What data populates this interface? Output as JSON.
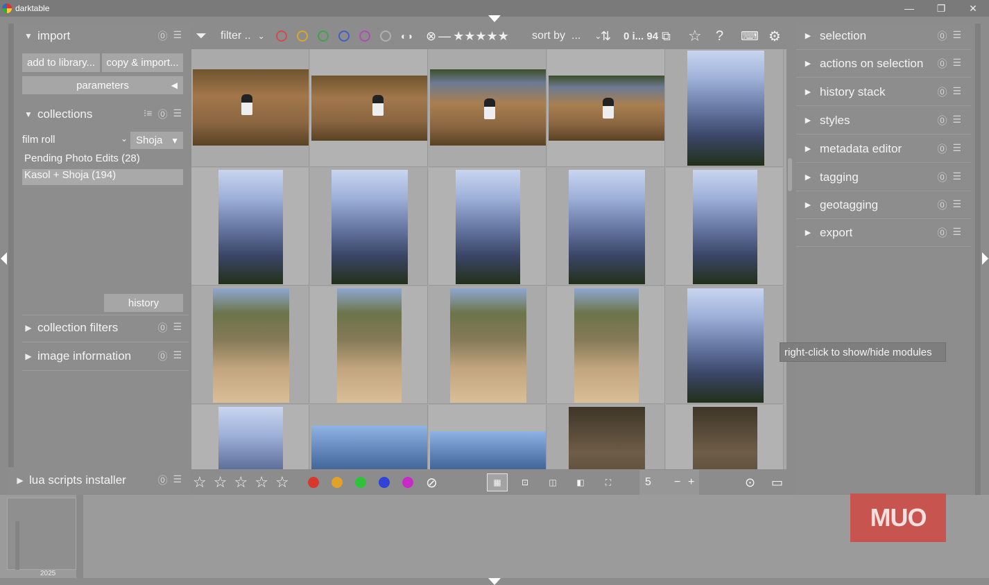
{
  "window": {
    "title": "darktable",
    "minimize": "—",
    "maximize": "❐",
    "close": "✕"
  },
  "left_panel": {
    "import": {
      "title": "import",
      "add_button": "add to library...",
      "copy_button": "copy & import...",
      "parameters": "parameters"
    },
    "collections": {
      "title": "collections",
      "property": "film roll",
      "value": "Shoja",
      "rolls": [
        "Pending Photo Edits (28)",
        "Kasol + Shoja (194)"
      ],
      "history_button": "history"
    },
    "modules": [
      "collection filters",
      "image information",
      "lua scripts installer"
    ]
  },
  "toolbar": {
    "filter_label": "filter ..",
    "sort_label": "sort by",
    "sort_value": "...",
    "count": "0 i... 94",
    "rating_stars": "★★★★★",
    "color_labels": [
      "#d44a4a",
      "#d9a82c",
      "#3fa34a",
      "#3f5fc4",
      "#b24ab8",
      "#9b9b9b"
    ]
  },
  "bottom_toolbar": {
    "zoom_value": "5",
    "zoom_minus": "−",
    "zoom_plus": "+",
    "color_dots": [
      "#d8372d",
      "#e2a12a",
      "#2fc23a",
      "#3143d6",
      "#c82ac8"
    ]
  },
  "right_panel": {
    "modules": [
      "selection",
      "actions on selection",
      "history stack",
      "styles",
      "metadata editor",
      "tagging",
      "geotagging",
      "export"
    ],
    "tooltip": "right-click to show/hide modules"
  },
  "filmstrip": {
    "year": "2025"
  },
  "watermark": "MUO"
}
